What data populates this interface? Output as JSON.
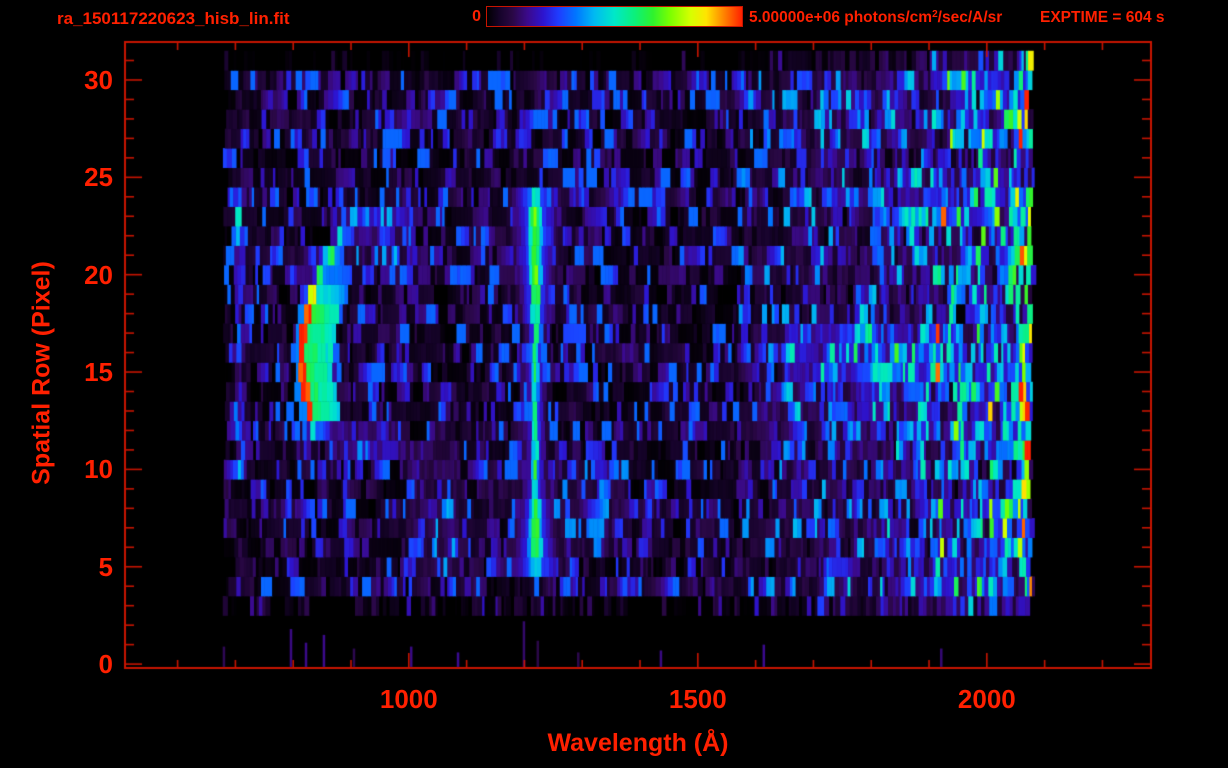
{
  "header": {
    "title": "ra_150117220623_hisb_lin.fit",
    "exptime_label": "EXPTIME = 604 s"
  },
  "colorbar": {
    "min_label": "0",
    "max_label_prefix": "5.00000e+06 photons/cm",
    "max_label_sup": "2",
    "max_label_suffix": "/sec/A/sr"
  },
  "colors": {
    "background": "#000000",
    "axis": "#c81400",
    "label": "#ff2000"
  },
  "chart_data": {
    "type": "heatmap",
    "title": "ra_150117220623_hisb_lin.fit",
    "xlabel": "Wavelength (Å)",
    "ylabel": "Spatial Row (Pixel)",
    "x_unit": "Å",
    "y_unit": "pixel row",
    "x_range": [
      509,
      2284
    ],
    "y_range": [
      -0.2,
      31.95
    ],
    "x_major_ticks": [
      {
        "v": 1000,
        "label": "1000"
      },
      {
        "v": 1500,
        "label": "1500"
      },
      {
        "v": 2000,
        "label": "2000"
      }
    ],
    "x_minor_ticks": {
      "from": 600,
      "to": 2200,
      "step": 100
    },
    "y_major_ticks": [
      {
        "v": 0,
        "label": "0"
      },
      {
        "v": 5,
        "label": "5"
      },
      {
        "v": 10,
        "label": "10"
      },
      {
        "v": 15,
        "label": "15"
      },
      {
        "v": 20,
        "label": "20"
      },
      {
        "v": 25,
        "label": "25"
      },
      {
        "v": 30,
        "label": "30"
      }
    ],
    "y_minor_ticks": {
      "from": 0,
      "to": 31,
      "step": 1
    },
    "colorbar_range_photons": [
      0,
      5000000
    ],
    "colorbar_units": "photons/cm2/sec/A/sr",
    "exposure_time_s": 604,
    "data_extent": [
      678,
      2074
    ],
    "data_row_extent": [
      3,
      31
    ],
    "seed": 7,
    "colormap": [
      [
        0.0,
        "#000000"
      ],
      [
        0.05,
        "#16032a"
      ],
      [
        0.1,
        "#2a0845"
      ],
      [
        0.16,
        "#3b0a8c"
      ],
      [
        0.22,
        "#2d14cf"
      ],
      [
        0.28,
        "#1f3cff"
      ],
      [
        0.35,
        "#0077ff"
      ],
      [
        0.42,
        "#00b9f2"
      ],
      [
        0.5,
        "#00e8c8"
      ],
      [
        0.58,
        "#0cf07a"
      ],
      [
        0.65,
        "#2ef22e"
      ],
      [
        0.72,
        "#7dff00"
      ],
      [
        0.8,
        "#d8ff00"
      ],
      [
        0.86,
        "#ffe400"
      ],
      [
        0.92,
        "#ff9000"
      ],
      [
        1.0,
        "#ff2000"
      ]
    ],
    "features": [
      {
        "id": "airglow-crescent",
        "type": "crescent",
        "vertex_A": 812,
        "row_vertex": 15.5,
        "curvature": 1.55,
        "row_min": 11.4,
        "row_max": 23.6,
        "core_halfwidth_A": 6,
        "shelf_A": 55,
        "peak_frac": 1.0
      },
      {
        "id": "emission-line",
        "type": "emission_line",
        "center_A": 1216,
        "row_min": 4.7,
        "row_max": 24.2,
        "sigma_mid_A": 5.5,
        "peak_frac": 0.68
      },
      {
        "id": "longwave-continuum",
        "type": "ramp",
        "start_A": 1570,
        "end_A": 2074,
        "max_add": 0.2
      }
    ],
    "boosts": [
      {
        "rows": [
          15,
          17
        ],
        "lam": [
          1650,
          1955
        ],
        "add": 0.13
      },
      {
        "rows": [
          12.8,
          14.9
        ],
        "lam": [
          1600,
          1900
        ],
        "add": 0.05
      },
      {
        "rows": [
          5,
          11
        ],
        "lam": [
          995,
          1085
        ],
        "add": 0.07
      },
      {
        "rows": [
          6,
          10.5
        ],
        "lam": [
          1230,
          1380
        ],
        "add": 0.05
      },
      {
        "rows": [
          9.5,
          23
        ],
        "lam": [
          697,
          707
        ],
        "add": 0.13
      },
      {
        "rows": [
          21.8,
          23.6
        ],
        "lam": [
          860,
          1010
        ],
        "add": 0.12
      },
      {
        "rows": [
          20.5,
          21.8
        ],
        "lam": [
          850,
          980
        ],
        "add": 0.07
      },
      {
        "rows": [
          11,
          12.4
        ],
        "lam": [
          850,
          1000
        ],
        "add": 0.1
      }
    ],
    "bottom_spikes": [
      [
        678,
        0.9
      ],
      [
        794,
        1.8
      ],
      [
        820,
        1.1
      ],
      [
        851,
        1.5
      ],
      [
        903,
        0.8
      ],
      [
        1002,
        0.9
      ],
      [
        1083,
        0.6
      ],
      [
        1197,
        2.2
      ],
      [
        1221,
        1.2
      ],
      [
        1291,
        0.6
      ],
      [
        1434,
        0.7
      ],
      [
        1612,
        1.0
      ],
      [
        1919,
        0.8
      ]
    ]
  }
}
